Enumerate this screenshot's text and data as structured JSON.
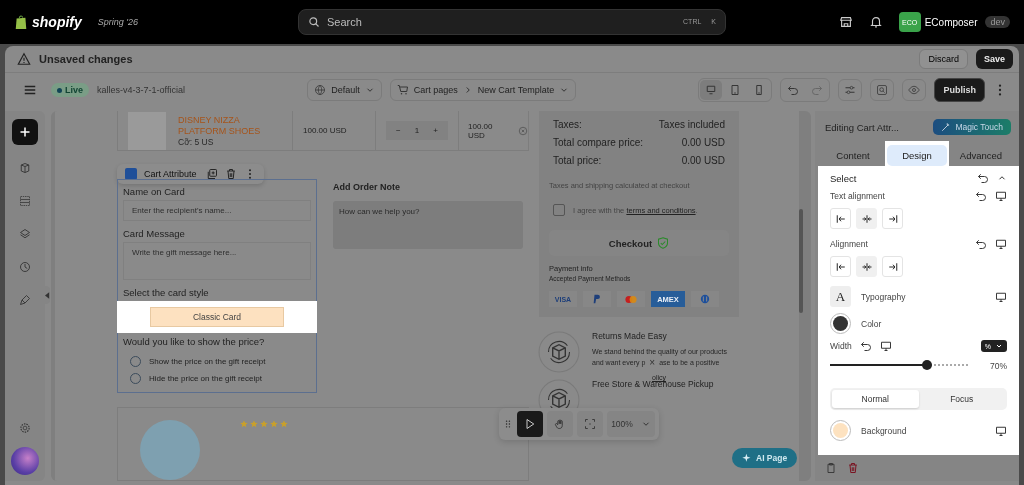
{
  "topbar": {
    "brand": "shopify",
    "version": "Spring '26",
    "search": {
      "placeholder": "Search",
      "keys": [
        "CTRL",
        "K"
      ]
    },
    "user": {
      "initials": "ECO",
      "name": "EComposer",
      "badge": "dev"
    }
  },
  "header": {
    "title": "Unsaved changes",
    "discard": "Discard",
    "save": "Save"
  },
  "toolbar": {
    "status": "Live",
    "site": "kalles-v4-3-7-1-official",
    "language": "Default",
    "breadcrumb": [
      "Cart pages",
      "New Cart Template"
    ],
    "devices": [
      {
        "kind": "desktop",
        "selected": true
      },
      {
        "kind": "tablet",
        "selected": false
      },
      {
        "kind": "mobile",
        "selected": false
      }
    ],
    "publish": "Publish"
  },
  "cart_item": {
    "name": "DISNEY NIZZA PLATFORM SHOES",
    "variant": "Cỡ: 5 US",
    "price": "100.00 USD",
    "quantity": "1",
    "minus": "−",
    "plus": "+",
    "total": "100.00 USD"
  },
  "element_toolbar": {
    "label": "Cart Attribute"
  },
  "form": {
    "fields": [
      {
        "kind": "input",
        "label": "Name on Card",
        "placeholder": "Enter the recipient's name..."
      },
      {
        "kind": "textarea",
        "label": "Card Message",
        "placeholder": "Write the gift message here..."
      }
    ],
    "style_label": "Select the card style",
    "card_style": "Classic Card",
    "question": "Would you like to show the price?",
    "options": [
      {
        "label": "Show the price on the gift receipt",
        "selected": false
      },
      {
        "label": "Hide the price on the gift receipt",
        "selected": false
      }
    ]
  },
  "order_note": {
    "title": "Add Order Note",
    "placeholder": "How can we help you?"
  },
  "reviews": {
    "stars": 5
  },
  "summary": {
    "rows": [
      {
        "label": "Taxes:",
        "value": "Taxes included"
      },
      {
        "label": "Total compare price:",
        "value": "0.00 USD"
      },
      {
        "label": "Total price:",
        "value": "0.00 USD"
      }
    ],
    "note": "Taxes and shipping calculated at checkout",
    "agree": {
      "text": "I agree with the ",
      "link": "terms and conditions",
      "end": ".",
      "checked": false
    },
    "checkout": "Checkout",
    "payment_title": "Payment info",
    "payment_subtitle": "Accepted Payment Methods",
    "payment_methods": [
      {
        "kind": "visa",
        "label": "VISA"
      },
      {
        "kind": "paypal"
      },
      {
        "kind": "mastercard"
      },
      {
        "kind": "amex",
        "label": "AMEX"
      },
      {
        "kind": "diners"
      }
    ]
  },
  "features": [
    {
      "title": "Returns Made Easy",
      "lines": [
        "We stand behind the quality of our products",
        "and want every p",
        "ase to be a positive"
      ],
      "link": "olicy"
    },
    {
      "title": "Free Store & Warehouse Pickup"
    }
  ],
  "canvas_tools": {
    "close": "×",
    "tools": [
      {
        "kind": "pointer",
        "selected": true
      },
      {
        "kind": "hand",
        "selected": false
      },
      {
        "kind": "focus",
        "selected": false
      }
    ],
    "zoom": "100%"
  },
  "ai_button": "AI Page",
  "panel": {
    "title": "Editing Cart Attr...",
    "magic": "Magic Touch",
    "tabs": [
      {
        "label": "Content",
        "selected": false
      },
      {
        "label": "Design",
        "selected": true
      },
      {
        "label": "Advanced",
        "selected": false
      }
    ],
    "section": "Select",
    "text_alignment": {
      "label": "Text alignment",
      "options": [
        {
          "kind": "left",
          "selected": false
        },
        {
          "kind": "center",
          "selected": true
        },
        {
          "kind": "right",
          "selected": false
        }
      ]
    },
    "alignment": {
      "label": "Alignment",
      "options": [
        {
          "kind": "left",
          "selected": false
        },
        {
          "kind": "center",
          "selected": true
        },
        {
          "kind": "right",
          "selected": false
        }
      ]
    },
    "typography": {
      "glyph": "A",
      "label": "Typography"
    },
    "color": {
      "label": "Color",
      "color": "#333333"
    },
    "width": {
      "label": "Width",
      "unit": "%",
      "level": 0.7,
      "reading": "70%"
    },
    "states": [
      {
        "label": "Normal",
        "selected": true
      },
      {
        "label": "Focus",
        "selected": false
      }
    ],
    "background": {
      "label": "Background",
      "color": "#fde2c0"
    }
  }
}
